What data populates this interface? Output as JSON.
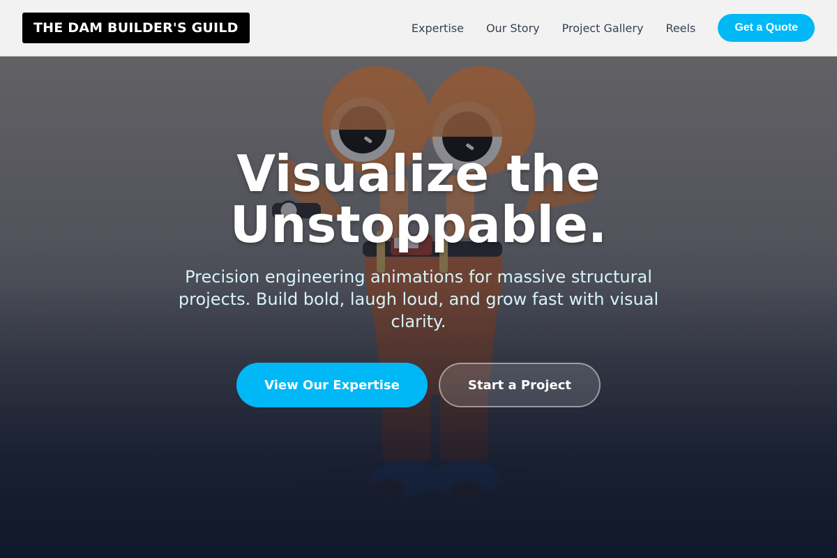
{
  "header": {
    "logo": "THE DAM BUILDER'S GUILD",
    "nav": [
      {
        "label": "Expertise"
      },
      {
        "label": "Our Story"
      },
      {
        "label": "Project Gallery"
      },
      {
        "label": "Reels"
      }
    ],
    "cta_label": "Get a Quote"
  },
  "hero": {
    "headline_line1": "Visualize the",
    "headline_line2": "Unstoppable.",
    "subhead": "Precision engineering animations for massive structural projects. Build bold, laugh loud, and grow fast with visual clarity.",
    "primary_cta": "View Our Expertise",
    "secondary_cta": "Start a Project",
    "background_image": "orange-beaver-character-illustration"
  },
  "colors": {
    "accent": "#00b8f5",
    "logo_bg": "#000000",
    "header_bg": "#f2f2f2",
    "hero_dark": "#0f172a"
  }
}
